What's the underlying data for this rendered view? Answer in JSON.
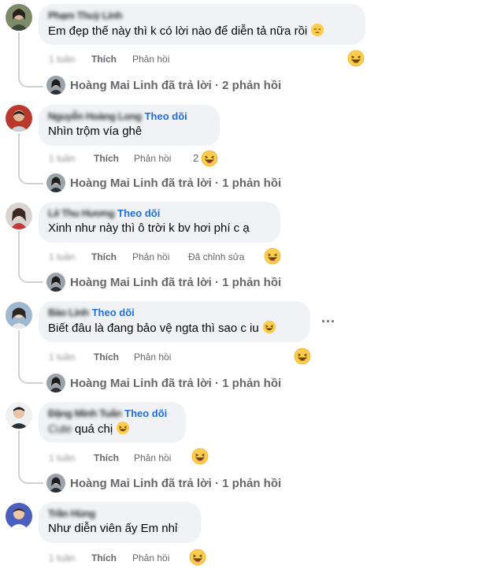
{
  "follow_label": "Theo dõi",
  "like_label": "Thích",
  "reply_label": "Phản hồi",
  "more_label": "...",
  "comments": [
    {
      "name": "Phạm Thuỳ Linh",
      "text": "Em đẹp thế này thì k có lời nào để diễn tả nữa rồi",
      "text_emoji": "pensive-emoji",
      "time": "1 tuần",
      "reaction_count": "",
      "edited_label": "",
      "replies_summary": "Hoàng Mai Linh đã trả lời · 2 phản hồi"
    },
    {
      "name": "Nguyễn Hoàng Long",
      "text": "Nhìn trộm vía ghê",
      "text_emoji": "",
      "time": "1 tuần",
      "reaction_count": "2",
      "edited_label": "",
      "replies_summary": "Hoàng Mai Linh đã trả lời · 1 phản hồi"
    },
    {
      "name": "Lê Thu Hương",
      "text": "Xinh như này thì ô trời k bv hơi phí c ạ",
      "text_emoji": "",
      "time": "1 tuần",
      "reaction_count": "",
      "edited_label": "Đã chỉnh sửa",
      "replies_summary": "Hoàng Mai Linh đã trả lời · 1 phản hồi"
    },
    {
      "name": "Bảo Linh",
      "text": "Biết đâu là đang bảo vệ ngta thì sao c iu",
      "text_emoji": "laughing-emoji",
      "time": "1 tuần",
      "reaction_count": "",
      "edited_label": "",
      "replies_summary": "Hoàng Mai Linh đã trả lời · 1 phản hồi"
    },
    {
      "name": "Đặng Minh Tuấn",
      "text": "quá chị",
      "text_prefix": "Cute",
      "text_emoji": "laughing-emoji",
      "time": "1 tuần",
      "reaction_count": "",
      "edited_label": "",
      "replies_summary": "Hoàng Mai Linh đã trả lời · 1 phản hồi"
    },
    {
      "name": "Trần Hùng",
      "text": "Như diễn viên ấy Em nhỉ",
      "text_emoji": "",
      "time": "1 tuần",
      "reaction_count": "",
      "edited_label": "",
      "replies_summary": ""
    }
  ],
  "colors": {
    "bubble": "#f0f2f5",
    "follow": "#216fdb",
    "muted": "#65676b",
    "thread_line": "#ced0d4"
  }
}
